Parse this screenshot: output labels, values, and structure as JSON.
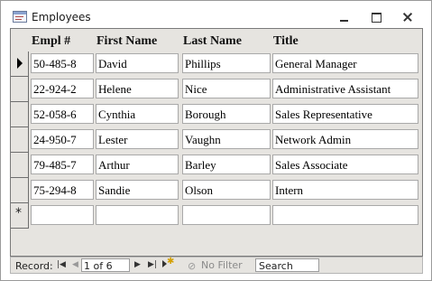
{
  "window": {
    "title": "Employees",
    "icon": "form-icon"
  },
  "columns": [
    "Empl #",
    "First Name",
    "Last Name",
    "Title"
  ],
  "rows": [
    [
      "50-485-8",
      "David",
      "Phillips",
      "General Manager"
    ],
    [
      "22-924-2",
      "Helene",
      "Nice",
      "Administrative Assistant"
    ],
    [
      "52-058-6",
      "Cynthia",
      "Borough",
      "Sales Representative"
    ],
    [
      "24-950-7",
      "Lester",
      "Vaughn",
      "Network Admin"
    ],
    [
      "79-485-7",
      "Arthur",
      "Barley",
      "Sales Associate"
    ],
    [
      "75-294-8",
      "Sandie",
      "Olson",
      "Intern"
    ]
  ],
  "new_row_marker": "*",
  "status": {
    "record_label": "Record:",
    "position": "1 of 6",
    "filter_label": "No Filter",
    "search_placeholder": "Search"
  },
  "colors": {
    "form_bg": "#e6e4e0",
    "cell_bg": "#ffffff"
  }
}
